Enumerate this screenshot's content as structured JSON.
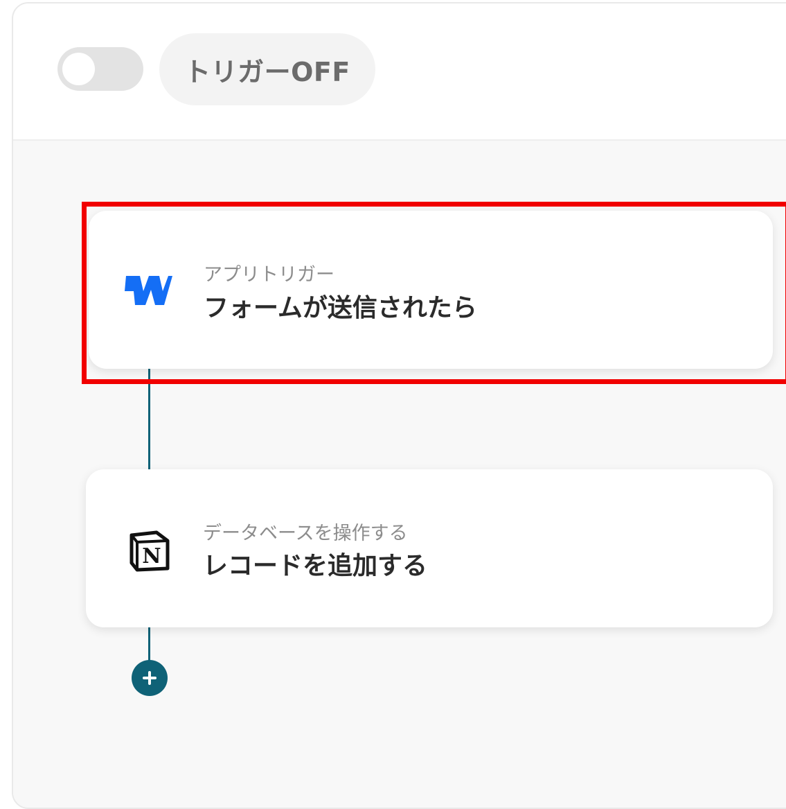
{
  "header": {
    "trigger_toggle": {
      "state": "off"
    },
    "trigger_status_label": "トリガーOFF"
  },
  "flow": {
    "steps": [
      {
        "app_icon": "webflow-icon",
        "subtitle": "アプリトリガー",
        "title": "フォームが送信されたら",
        "highlighted": true
      },
      {
        "app_icon": "notion-icon",
        "subtitle": "データベースを操作する",
        "title": "レコードを追加する",
        "highlighted": false
      }
    ],
    "add_step_icon": "plus-icon"
  },
  "colors": {
    "accent": "#0f6277",
    "highlight_border": "#f10000",
    "webflow_blue": "#146ef5",
    "toggle_off": "#e3e3e3"
  }
}
